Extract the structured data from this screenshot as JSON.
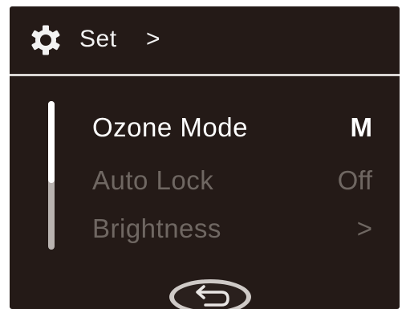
{
  "header": {
    "title": "Set",
    "chevron": ">",
    "icon": "gear-icon"
  },
  "menu": {
    "items": [
      {
        "label": "Ozone Mode",
        "value": "M",
        "state": "selected"
      },
      {
        "label": "Auto Lock",
        "value": "Off",
        "state": "normal"
      },
      {
        "label": "Brightness",
        "value": ">",
        "state": "normal"
      }
    ]
  },
  "footer": {
    "icon": "return-icon"
  },
  "colors": {
    "background": "#241a17",
    "active_text": "#ffffff",
    "inactive_text": "#6f6762",
    "divider": "#d9d6d4"
  }
}
